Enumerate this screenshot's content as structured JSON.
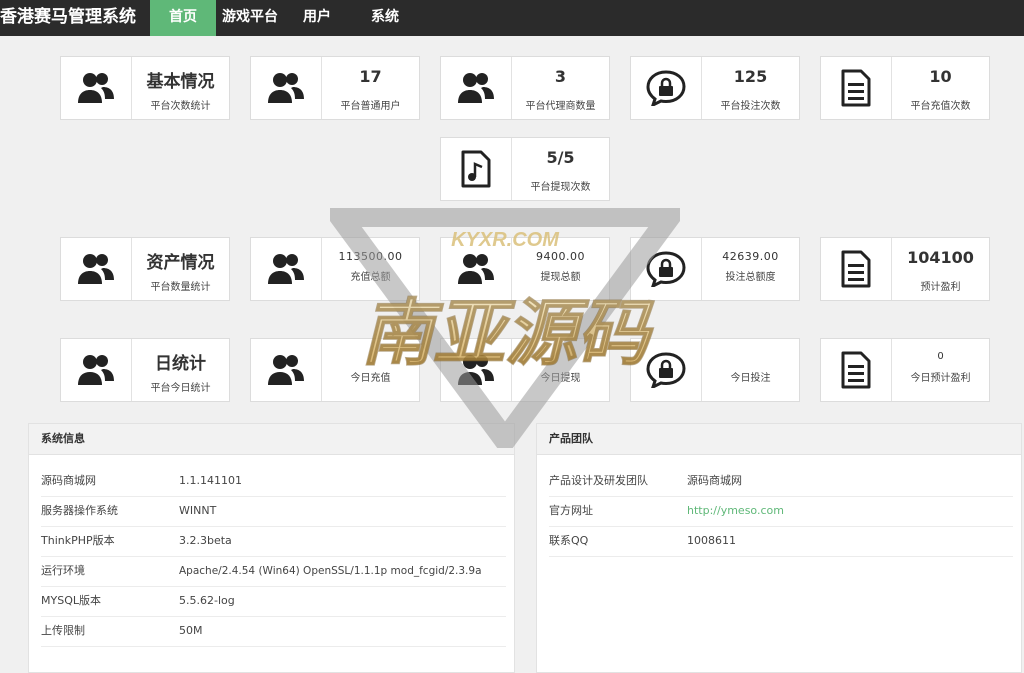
{
  "brand": "香港赛马管理系统",
  "nav": [
    {
      "label": "首页",
      "active": true
    },
    {
      "label": "游戏平台",
      "active": false
    },
    {
      "label": "用户",
      "active": false
    },
    {
      "label": "系统",
      "active": false
    }
  ],
  "tiles": {
    "basic": {
      "title": "基本情况",
      "sub": "平台次数统计"
    },
    "users": {
      "value": "17",
      "sub": "平台普通用户"
    },
    "agents": {
      "value": "3",
      "sub": "平台代理商数量"
    },
    "bets": {
      "value": "125",
      "sub": "平台投注次数"
    },
    "recharges": {
      "value": "10",
      "sub": "平台充值次数"
    },
    "withdrawals": {
      "value": "5/5",
      "sub": "平台提现次数"
    },
    "assets": {
      "title": "资产情况",
      "sub": "平台数量统计"
    },
    "recharge_total": {
      "value": "113500.00",
      "sub": "充值总额"
    },
    "withdraw_total": {
      "value": "9400.00",
      "sub": "提现总额"
    },
    "bet_total": {
      "value": "42639.00",
      "sub": "投注总额度"
    },
    "profit_est": {
      "value": "104100",
      "sub": "预计盈利"
    },
    "daily": {
      "title": "日统计",
      "sub": "平台今日统计"
    },
    "today_recharge": {
      "sub": "今日充值"
    },
    "today_withdraw": {
      "sub": "今日提现"
    },
    "today_bet": {
      "sub": "今日投注"
    },
    "today_profit": {
      "value": "0",
      "sub": "今日预计盈利"
    }
  },
  "system_panel": {
    "title": "系统信息",
    "rows": [
      {
        "k": "源码商城网",
        "v": "1.1.141101"
      },
      {
        "k": "服务器操作系统",
        "v": "WINNT"
      },
      {
        "k": "ThinkPHP版本",
        "v": "3.2.3beta"
      },
      {
        "k": "运行环境",
        "v": "Apache/2.4.54 (Win64) OpenSSL/1.1.1p mod_fcgid/2.3.9a"
      },
      {
        "k": "MYSQL版本",
        "v": "5.5.62-log"
      },
      {
        "k": "上传限制",
        "v": "50M"
      }
    ]
  },
  "team_panel": {
    "title": "产品团队",
    "rows": [
      {
        "k": "产品设计及研发团队",
        "v": "源码商城网"
      },
      {
        "k": "官方网址",
        "v": "http://ymeso.com"
      },
      {
        "k": "联系QQ",
        "v": "1008611"
      }
    ]
  },
  "watermark": {
    "top_text": "KYXR.COM",
    "main_text": "南亚源码"
  },
  "colors": {
    "nav_bg": "#2b2b2b",
    "accent": "#5fb878",
    "page_bg": "#f0f0f0"
  }
}
